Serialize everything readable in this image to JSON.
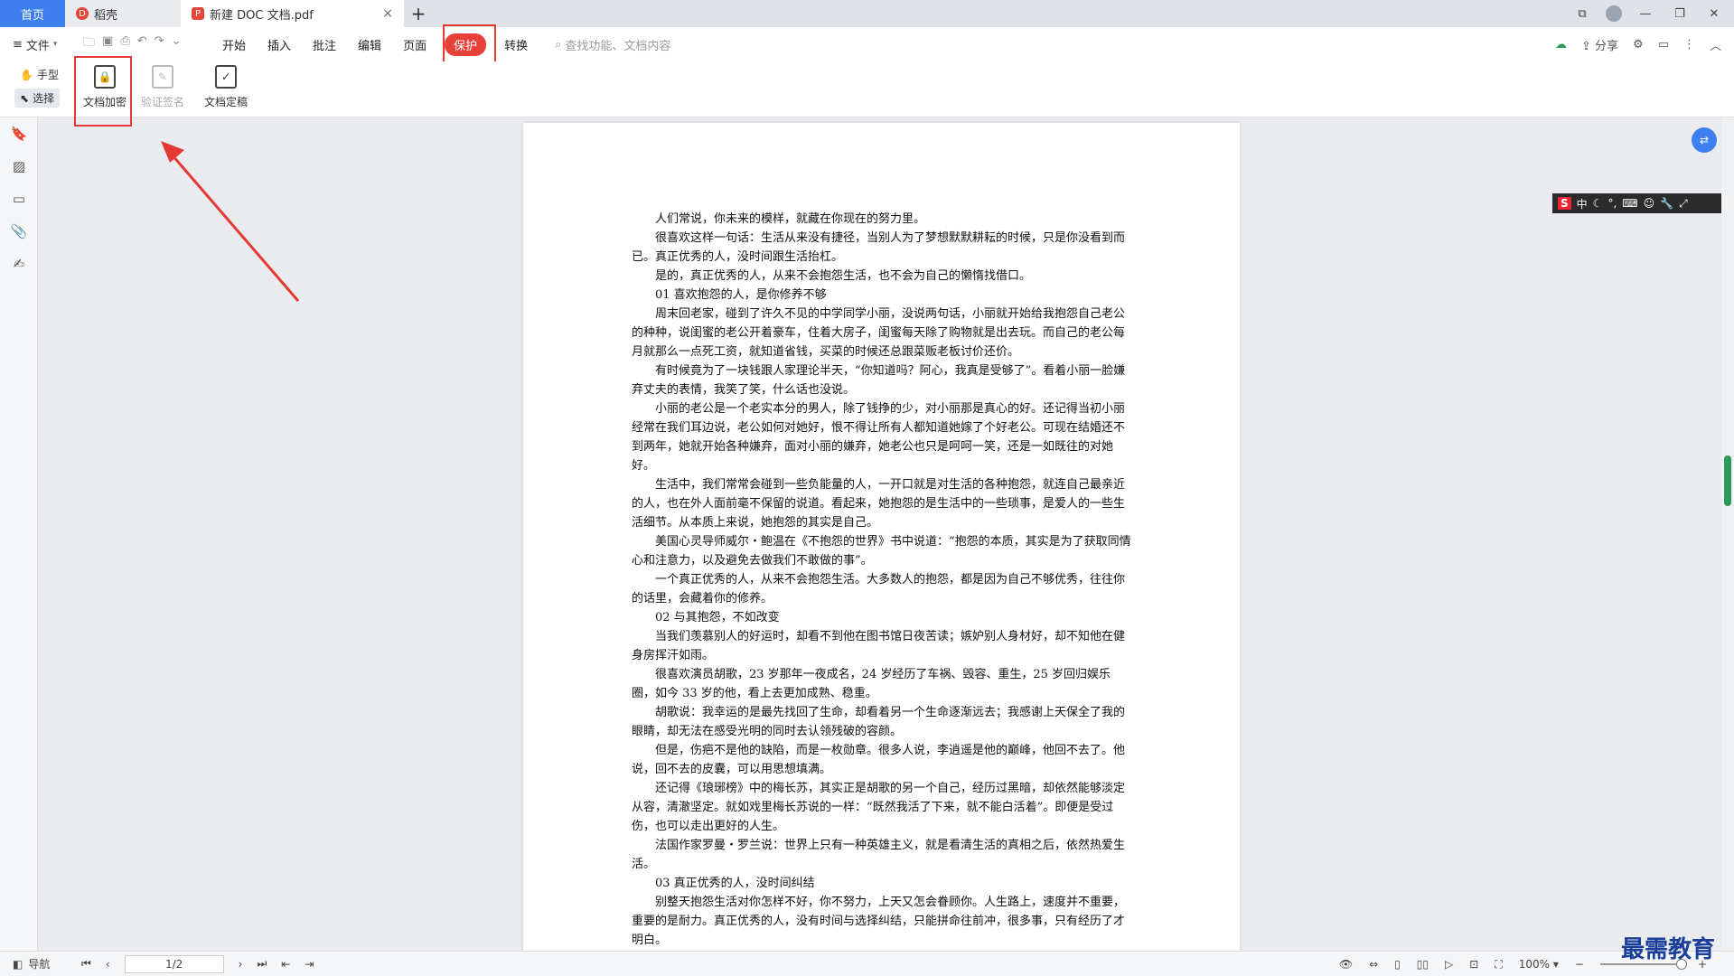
{
  "tabs": {
    "home": "首页",
    "draft": "稻壳",
    "doc": "新建 DOC 文档.pdf",
    "doc_icon": "pdf-icon",
    "close": "×",
    "new_tab": "+"
  },
  "menu": {
    "file": "文件",
    "items": [
      "开始",
      "插入",
      "批注",
      "编辑",
      "页面",
      "保护",
      "转换"
    ],
    "active_index": 5,
    "search_placeholder": "查找功能、文档内容",
    "share": "分享",
    "accent_color": "#e8413a"
  },
  "ribbon": {
    "hand": "手型",
    "select": "选择",
    "buttons": [
      {
        "label": "文档加密",
        "icon": "document-lock-icon",
        "enabled": true
      },
      {
        "label": "验证签名",
        "icon": "signature-pen-icon",
        "enabled": false
      },
      {
        "label": "文档定稿",
        "icon": "document-check-icon",
        "enabled": true
      }
    ]
  },
  "document": {
    "paragraphs": [
      "人们常说，你未来的模样，就藏在你现在的努力里。",
      "很喜欢这样一句话：生活从来没有捷径，当别人为了梦想默默耕耘的时候，只是你没看到而已。真正优秀的人，没时间跟生活抬杠。",
      "是的，真正优秀的人，从来不会抱怨生活，也不会为自己的懒惰找借口。",
      "01 喜欢抱怨的人，是你修养不够",
      "周末回老家，碰到了许久不见的中学同学小丽，没说两句话，小丽就开始给我抱怨自己老公的种种，说闺蜜的老公开着豪车，住着大房子，闺蜜每天除了购物就是出去玩。而自己的老公每月就那么一点死工资，就知道省钱，买菜的时候还总跟菜贩老板讨价还价。",
      "有时候竟为了一块钱跟人家理论半天，“你知道吗？阿心，我真是受够了”。看着小丽一脸嫌弃丈夫的表情，我笑了笑，什么话也没说。",
      "小丽的老公是一个老实本分的男人，除了钱挣的少，对小丽那是真心的好。还记得当初小丽经常在我们耳边说，老公如何对她好，恨不得让所有人都知道她嫁了个好老公。可现在结婚还不到两年，她就开始各种嫌弃，面对小丽的嫌弃，她老公也只是呵呵一笑，还是一如既往的对她好。",
      "生活中，我们常常会碰到一些负能量的人，一开口就是对生活的各种抱怨，就连自己最亲近的人，也在外人面前毫不保留的说道。看起来，她抱怨的是生活中的一些琐事，是爱人的一些生活细节。从本质上来说，她抱怨的其实是自己。",
      "美国心灵导师威尔・鲍温在《不抱怨的世界》书中说道：“抱怨的本质，其实是为了获取同情心和注意力，以及避免去做我们不敢做的事”。",
      "一个真正优秀的人，从来不会抱怨生活。大多数人的抱怨，都是因为自己不够优秀，往往你的话里，会藏着你的修养。",
      "02 与其抱怨，不如改变",
      "当我们羡慕别人的好运时，却看不到他在图书馆日夜苦读；嫉妒别人身材好，却不知他在健身房挥汗如雨。",
      "很喜欢演员胡歌，23 岁那年一夜成名，24 岁经历了车祸、毁容、重生，25 岁回归娱乐圈，如今 33 岁的他，看上去更加成熟、稳重。",
      "胡歌说：我幸运的是最先找回了生命，却看着另一个生命逐渐远去；我感谢上天保全了我的眼睛，却无法在感受光明的同时去认领残破的容颜。",
      "但是，伤疤不是他的缺陷，而是一枚勋章。很多人说，李逍遥是他的巅峰，他回不去了。他说，回不去的皮囊，可以用思想填满。",
      "还记得《琅琊榜》中的梅长苏，其实正是胡歌的另一个自己，经历过黑暗，却依然能够淡定从容，清澈坚定。就如戏里梅长苏说的一样：“既然我活了下来，就不能白活着”。即便是受过伤，也可以走出更好的人生。",
      "法国作家罗曼・罗兰说：世界上只有一种英雄主义，就是看清生活的真相之后，依然热爱生活。",
      "03 真正优秀的人，没时间纠结",
      "别整天抱怨生活对你怎样不好，你不努力，上天又怎会眷顾你。人生路上，速度并不重要，重要的是耐力。真正优秀的人，没有时间与选择纠结，只能拼命往前冲，很多事，只有经历了才明白。"
    ]
  },
  "status": {
    "nav": "导航",
    "page": "1/2",
    "zoom": "100%",
    "zoom_fraction": 1.0
  },
  "ime": {
    "brand": "S",
    "lang": "中"
  },
  "watermark": "最需教育"
}
